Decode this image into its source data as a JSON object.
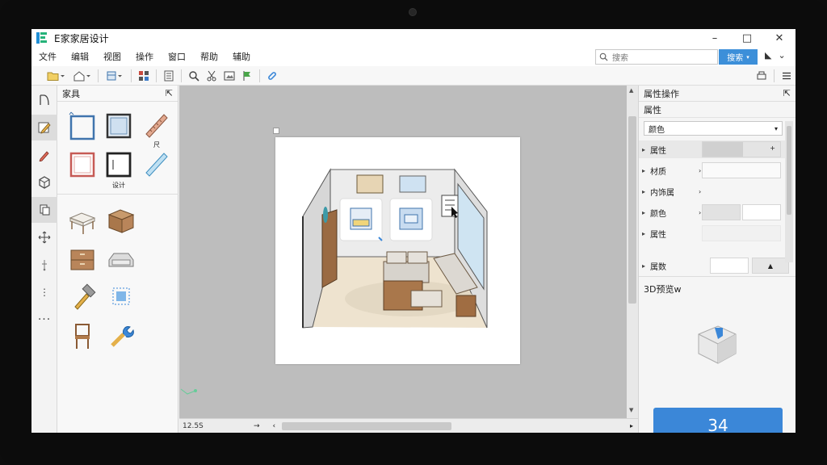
{
  "app": {
    "title": "E家家居设计"
  },
  "window_controls": {
    "minimize": "–",
    "maximize": "□",
    "close": "✕"
  },
  "menu": [
    "文件",
    "编辑",
    "视图",
    "操作",
    "窗口",
    "帮助",
    "辅助"
  ],
  "search": {
    "placeholder": "搜索",
    "button_label": "搜索"
  },
  "catalog": {
    "title": "家具",
    "pin": "⇱",
    "tools": [
      {
        "caption": ""
      },
      {
        "caption": ""
      },
      {
        "caption": "尺"
      },
      {
        "caption": ""
      },
      {
        "caption": "设计"
      },
      {
        "caption": ""
      }
    ]
  },
  "status": {
    "coordinates": "12.5S"
  },
  "properties": {
    "title": "属性操作",
    "pin": "⇱",
    "section": "属性",
    "select_value": "颜色",
    "rows": [
      {
        "label": "属性"
      },
      {
        "label": "材质"
      },
      {
        "label": "内饰属"
      },
      {
        "label": "颜色"
      },
      {
        "label": "属性"
      },
      {
        "label": "属数"
      }
    ],
    "preview_label": "3D预览w",
    "big_button": "34"
  },
  "colors": {
    "accent": "#3b87d8",
    "canvas_bg": "#bdbdbd"
  }
}
